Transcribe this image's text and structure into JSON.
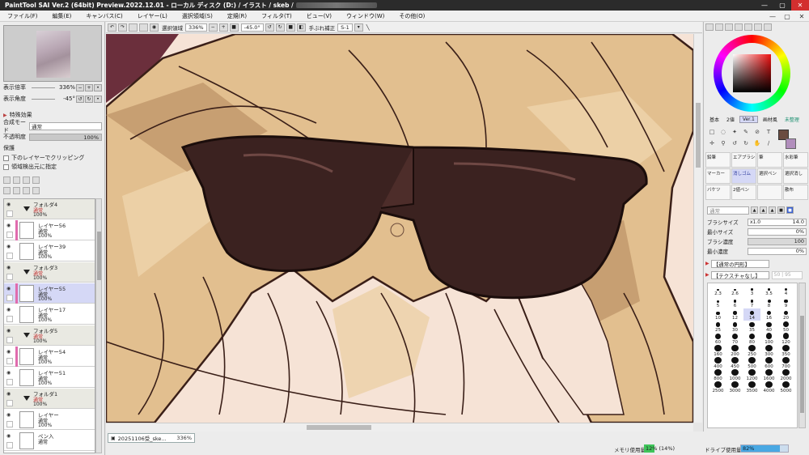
{
  "titlebar": {
    "title": "PaintTool SAI Ver.2 (64bit) Preview.2022.12.01 - ローカル ディスク (D:) / イラスト / skeb /",
    "controls": [
      "—",
      "▢",
      "✕"
    ]
  },
  "menu": {
    "items": [
      "ファイル(F)",
      "編集(E)",
      "キャンバス(C)",
      "レイヤー(L)",
      "選択領域(S)",
      "定規(R)",
      "フィルタ(T)",
      "ビュー(V)",
      "ウィンドウ(W)",
      "その他(O)"
    ],
    "window_controls": [
      "—",
      "▢",
      "✕"
    ]
  },
  "navigator": {
    "zoom_label": "表示倍率",
    "zoom_value": "336%",
    "angle_label": "表示角度",
    "angle_value": "-45°"
  },
  "layer_panel": {
    "effects_label": "特殊効果",
    "blend_mode_label": "合成モード",
    "blend_mode_value": "通常",
    "opacity_label": "不透明度",
    "opacity_value": "100%",
    "protect_label": "保護",
    "clip_label": "下のレイヤーでクリッピング",
    "select_source_label": "領域検出元に指定",
    "layers": [
      {
        "name": "フォルダ4",
        "mode": "通常",
        "opacity": "100%",
        "type": "folder",
        "mode_color": "red"
      },
      {
        "name": "レイヤー56",
        "mode": "通常",
        "opacity": "100%",
        "type": "layer",
        "clipped": true
      },
      {
        "name": "レイヤー39",
        "mode": "通常",
        "opacity": "100%",
        "type": "layer"
      },
      {
        "name": "フォルダ3",
        "mode": "通常",
        "opacity": "100%",
        "type": "folder",
        "mode_color": "red"
      },
      {
        "name": "レイヤー55",
        "mode": "通常",
        "opacity": "100%",
        "type": "layer",
        "clipped": true,
        "selected": true
      },
      {
        "name": "レイヤー17",
        "mode": "通常",
        "opacity": "100%",
        "type": "layer"
      },
      {
        "name": "フォルダ5",
        "mode": "通常",
        "opacity": "100%",
        "type": "folder",
        "mode_color": "red"
      },
      {
        "name": "レイヤー54",
        "mode": "通常",
        "opacity": "100%",
        "type": "layer",
        "clipped": true
      },
      {
        "name": "レイヤー51",
        "mode": "通常",
        "opacity": "100%",
        "type": "layer"
      },
      {
        "name": "フォルダ1",
        "mode": "通常",
        "opacity": "100%",
        "type": "folder",
        "mode_color": "red"
      },
      {
        "name": "レイヤー",
        "mode": "通常",
        "opacity": "100%",
        "type": "layer"
      },
      {
        "name": "ペン入",
        "mode": "通常",
        "opacity": "",
        "type": "layer"
      }
    ]
  },
  "canvas_toolbar": {
    "selection_label": "選択領域",
    "zoom": "336%",
    "angle": "-45.0°",
    "stabilizer_label": "手ぶれ補正",
    "stabilizer_value": "S-1"
  },
  "document_tab": {
    "name": "20251106受_ske...",
    "zoom": "336%"
  },
  "status": {
    "memory_label": "メモリ使用量",
    "memory_value": "12% (14%)",
    "drive_label": "ドライブ使用量",
    "drive_value": "82%",
    "drive_fraction": 0.82
  },
  "color_panel": {
    "tabs": [
      "基本",
      "2値",
      "Ver.1",
      "画材風",
      "未整理"
    ],
    "active_tab": "Ver.1",
    "fg_color": "#6a4b40",
    "bg_color": "#b18ebc"
  },
  "tools": {
    "icons": [
      "select-rect-icon",
      "lasso-icon",
      "magic-wand-icon",
      "pen-icon",
      "eyedropper-icon",
      "text-icon",
      "move-icon",
      "zoom-icon",
      "rotate-ccw-icon",
      "rotate-cw-icon",
      "hand-icon",
      "eyedropper2-icon"
    ],
    "brushes": [
      {
        "label": "鉛筆",
        "sel": false
      },
      {
        "label": "エアブラシ",
        "sel": false
      },
      {
        "label": "筆",
        "sel": false
      },
      {
        "label": "水彩筆",
        "sel": false
      },
      {
        "label": "マーカー",
        "sel": false
      },
      {
        "label": "消しゴム",
        "sel": true
      },
      {
        "label": "選択ペン",
        "sel": false
      },
      {
        "label": "選択消し",
        "sel": false
      },
      {
        "label": "バケツ",
        "sel": false
      },
      {
        "label": "2値ペン",
        "sel": false
      },
      {
        "label": "",
        "sel": false
      },
      {
        "label": "散布",
        "sel": false
      }
    ]
  },
  "brush_settings": {
    "mode_placeholder": "通常",
    "size_label": "ブラシサイズ",
    "size_mult": "x1.0",
    "size_value": "14.0",
    "min_size_label": "最小サイズ",
    "min_size_value": "0%",
    "density_label": "ブラシ濃度",
    "density_value": "100",
    "min_density_label": "最小濃度",
    "min_density_value": "0%",
    "shape_label": "【通常の円形】",
    "texture_label": "【テクスチャなし】",
    "texture_value": "50 | 95"
  },
  "brush_sizes": [
    "2.3",
    "2.6",
    "3",
    "3.5",
    "4",
    "5",
    "6",
    "7",
    "8",
    "9",
    "10",
    "12",
    "14",
    "16",
    "20",
    "25",
    "30",
    "35",
    "40",
    "50",
    "60",
    "70",
    "80",
    "100",
    "120",
    "160",
    "200",
    "250",
    "300",
    "350",
    "400",
    "450",
    "500",
    "600",
    "700",
    "800",
    "1000",
    "1200",
    "1600",
    "2000",
    "2500",
    "3000",
    "3500",
    "4000",
    "5000"
  ],
  "selected_brush_size": "14"
}
